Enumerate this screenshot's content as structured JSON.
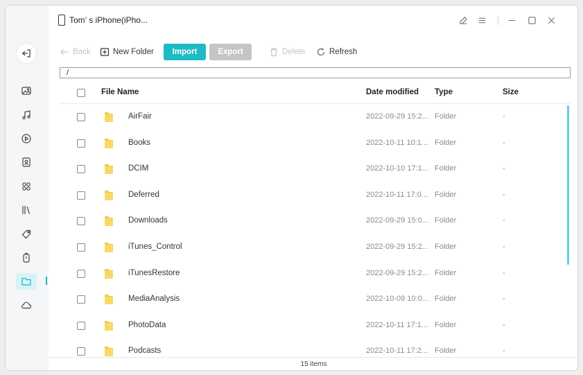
{
  "window": {
    "device_name": "Tom’ s iPhone(iPho..."
  },
  "sidebar": {
    "items": [
      {
        "icon": "photos-icon"
      },
      {
        "icon": "music-icon"
      },
      {
        "icon": "video-icon"
      },
      {
        "icon": "contacts-icon"
      },
      {
        "icon": "apps-icon"
      },
      {
        "icon": "books-icon"
      },
      {
        "icon": "ringtone-icon"
      },
      {
        "icon": "backup-icon"
      },
      {
        "icon": "files-icon",
        "active": true
      },
      {
        "icon": "cloud-icon"
      }
    ],
    "accent": "#18b5c2"
  },
  "toolbar": {
    "back": "Back",
    "new_folder": "New Folder",
    "import": "Import",
    "export": "Export",
    "delete": "Delete",
    "refresh": "Refresh"
  },
  "path": "/",
  "table": {
    "headers": {
      "name": "File Name",
      "date": "Date modified",
      "type": "Type",
      "size": "Size"
    },
    "rows": [
      {
        "name": "AirFair",
        "date": "2022-09-29 15:2...",
        "type": "Folder",
        "size": "-"
      },
      {
        "name": "Books",
        "date": "2022-10-11 10:1...",
        "type": "Folder",
        "size": "-"
      },
      {
        "name": "DCIM",
        "date": "2022-10-10 17:1...",
        "type": "Folder",
        "size": "-"
      },
      {
        "name": "Deferred",
        "date": "2022-10-11 17:0...",
        "type": "Folder",
        "size": "-"
      },
      {
        "name": "Downloads",
        "date": "2022-09-29 15:0...",
        "type": "Folder",
        "size": "-"
      },
      {
        "name": "iTunes_Control",
        "date": "2022-09-29 15:2...",
        "type": "Folder",
        "size": "-"
      },
      {
        "name": "iTunesRestore",
        "date": "2022-09-29 15:2...",
        "type": "Folder",
        "size": "-"
      },
      {
        "name": "MediaAnalysis",
        "date": "2022-10-09 10:0...",
        "type": "Folder",
        "size": "-"
      },
      {
        "name": "PhotoData",
        "date": "2022-10-11 17:1...",
        "type": "Folder",
        "size": "-"
      },
      {
        "name": "Podcasts",
        "date": "2022-10-11 17:2...",
        "type": "Folder",
        "size": "-"
      }
    ]
  },
  "footer": {
    "count": "15 items"
  },
  "colors": {
    "import_button": "#1ebbc6",
    "export_button_disabled": "#c5c5c5",
    "folder": "#f4c84a"
  }
}
